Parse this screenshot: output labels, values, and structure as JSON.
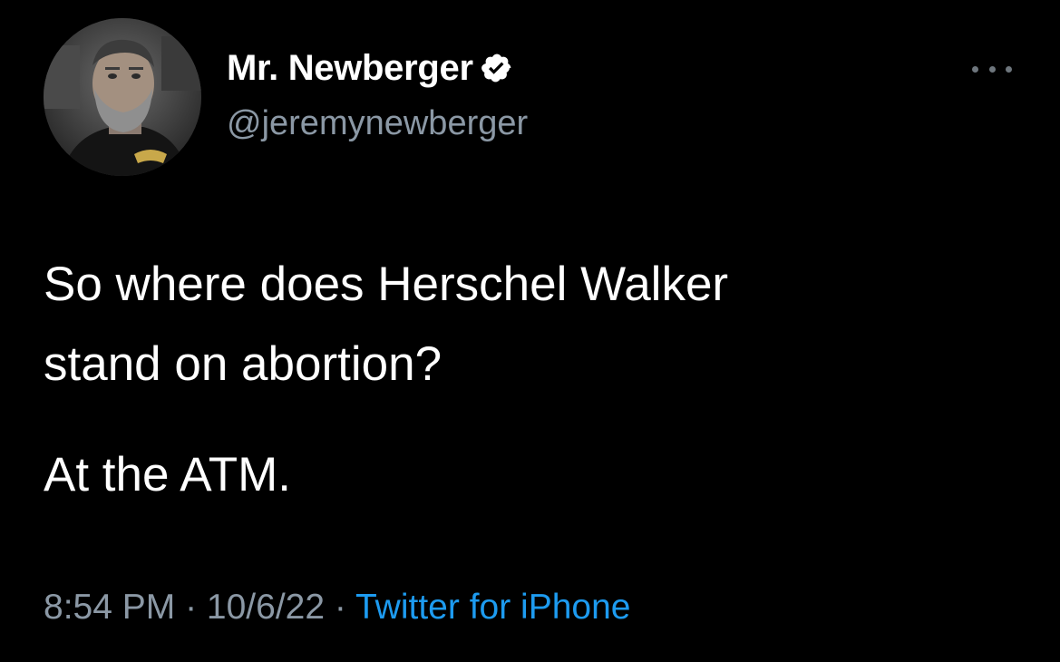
{
  "user": {
    "display_name": "Mr. Newberger",
    "handle": "@jeremynewberger",
    "verified": true
  },
  "tweet": {
    "text_line1": "So where does Herschel Walker",
    "text_line2": "stand on abortion?",
    "text_line3": "At the ATM.",
    "time": "8:54 PM",
    "separator": " · ",
    "date": "10/6/22",
    "source": "Twitter for iPhone"
  },
  "icons": {
    "verified": "verified-badge-icon",
    "more": "more-options-icon"
  },
  "colors": {
    "background": "#000000",
    "primary_text": "#ffffff",
    "secondary_text": "#8b98a5",
    "link": "#1d9bf0"
  }
}
